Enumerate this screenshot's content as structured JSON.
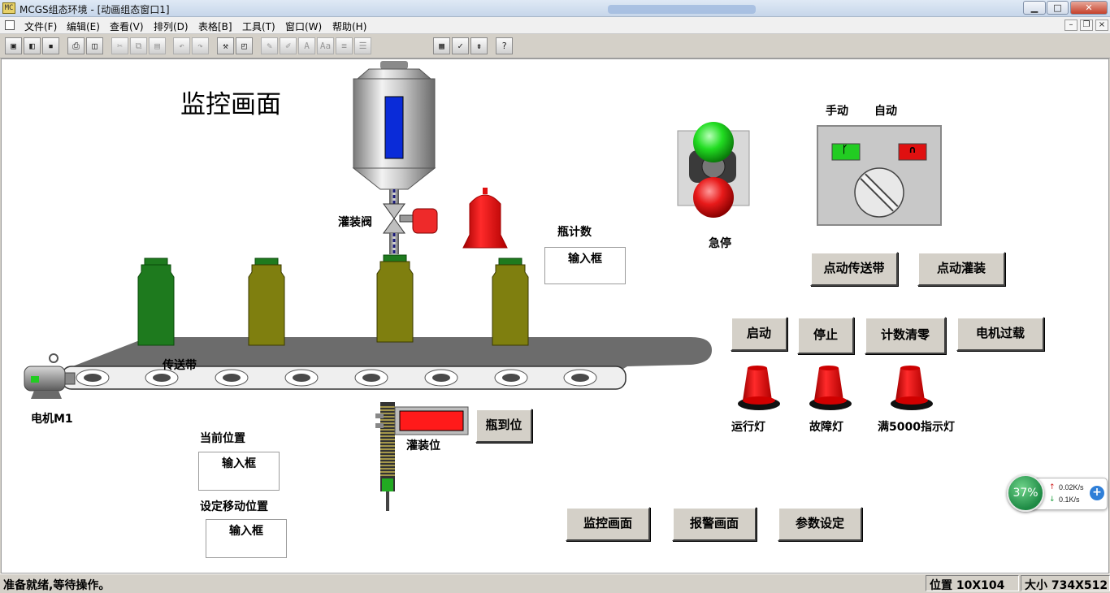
{
  "window": {
    "title": "MCGS组态环境 - [动画组态窗口1]",
    "app_icon_text": "MC",
    "controls": {
      "minimize": "▁",
      "maximize": "□",
      "close": "✕"
    }
  },
  "menubar": {
    "items": [
      "文件(F)",
      "编辑(E)",
      "查看(V)",
      "排列(D)",
      "表格[B]",
      "工具(T)",
      "窗口(W)",
      "帮助(H)"
    ],
    "mdi_controls": {
      "minimize": "–",
      "restore": "❐",
      "close": "×"
    }
  },
  "toolbar": {
    "buttons": [
      {
        "icon": "window-icon",
        "glyph": "▣"
      },
      {
        "icon": "object-icon",
        "glyph": "◧"
      },
      {
        "icon": "save-icon",
        "glyph": "▪"
      },
      {
        "icon": "print-icon",
        "glyph": "⎙"
      },
      {
        "icon": "preview-icon",
        "glyph": "◫"
      },
      {
        "icon": "cut-icon",
        "glyph": "✂"
      },
      {
        "icon": "copy-icon",
        "glyph": "⧉"
      },
      {
        "icon": "paste-icon",
        "glyph": "▤"
      },
      {
        "icon": "undo-icon",
        "glyph": "↶"
      },
      {
        "icon": "redo-icon",
        "glyph": "↷"
      },
      {
        "icon": "tools-icon",
        "glyph": "⚒"
      },
      {
        "icon": "frame-icon",
        "glyph": "◰"
      },
      {
        "icon": "edit-a-icon",
        "glyph": "✎"
      },
      {
        "icon": "edit-b-icon",
        "glyph": "✐"
      },
      {
        "icon": "font-a-icon",
        "glyph": "A"
      },
      {
        "icon": "font-aa-icon",
        "glyph": "Aa"
      },
      {
        "icon": "align-a-icon",
        "glyph": "≡"
      },
      {
        "icon": "align-b-icon",
        "glyph": "☰"
      },
      {
        "icon": "properties-icon",
        "glyph": "▦"
      },
      {
        "icon": "check-icon",
        "glyph": "✓"
      },
      {
        "icon": "list-icon",
        "glyph": "⇟"
      },
      {
        "icon": "help-icon",
        "glyph": "?"
      }
    ]
  },
  "canvas": {
    "title": "监控画面",
    "labels": {
      "valve": "灌装阀",
      "bottle_count": "瓶计数",
      "conveyor": "传送带",
      "motor": "电机M1",
      "current_position": "当前位置",
      "set_position": "设定移动位置",
      "fill_position": "灌装位",
      "estop": "急停",
      "manual": "手动",
      "auto": "自动",
      "run_lamp": "运行灯",
      "fault_lamp": "故障灯",
      "full_lamp": "满5000指示灯"
    },
    "inputs": {
      "bottle_count": "输入框",
      "current_position": "输入框",
      "set_position": "输入框"
    },
    "buttons": {
      "bottle_in_place": "瓶到位",
      "jog_conveyor": "点动传送带",
      "jog_fill": "点动灌装",
      "start": "启动",
      "stop": "停止",
      "reset_count": "计数清零",
      "motor_overload": "电机过载",
      "monitor": "监控画面",
      "alarm": "报警画面",
      "params": "参数设定"
    },
    "switch_indicators": {
      "manual": "ᚴ",
      "auto": "∩"
    }
  },
  "network_widget": {
    "percent": "37%",
    "up_rate": "0.02K/s",
    "down_rate": "0.1K/s",
    "up_arrow": "↑",
    "down_arrow": "↓",
    "plus": "+"
  },
  "statusbar": {
    "message": "准备就绪,等待操作。",
    "position": "位置 10X104",
    "size": "大小 734X512"
  },
  "colors": {
    "bottle_dark_green": "#1e7a1e",
    "bottle_olive": "#7f7f0f",
    "lamp_red": "#ff0000",
    "estop_green": "#22dd22",
    "estop_red": "#e81a1a",
    "tank_level": "#0a2bd8"
  }
}
